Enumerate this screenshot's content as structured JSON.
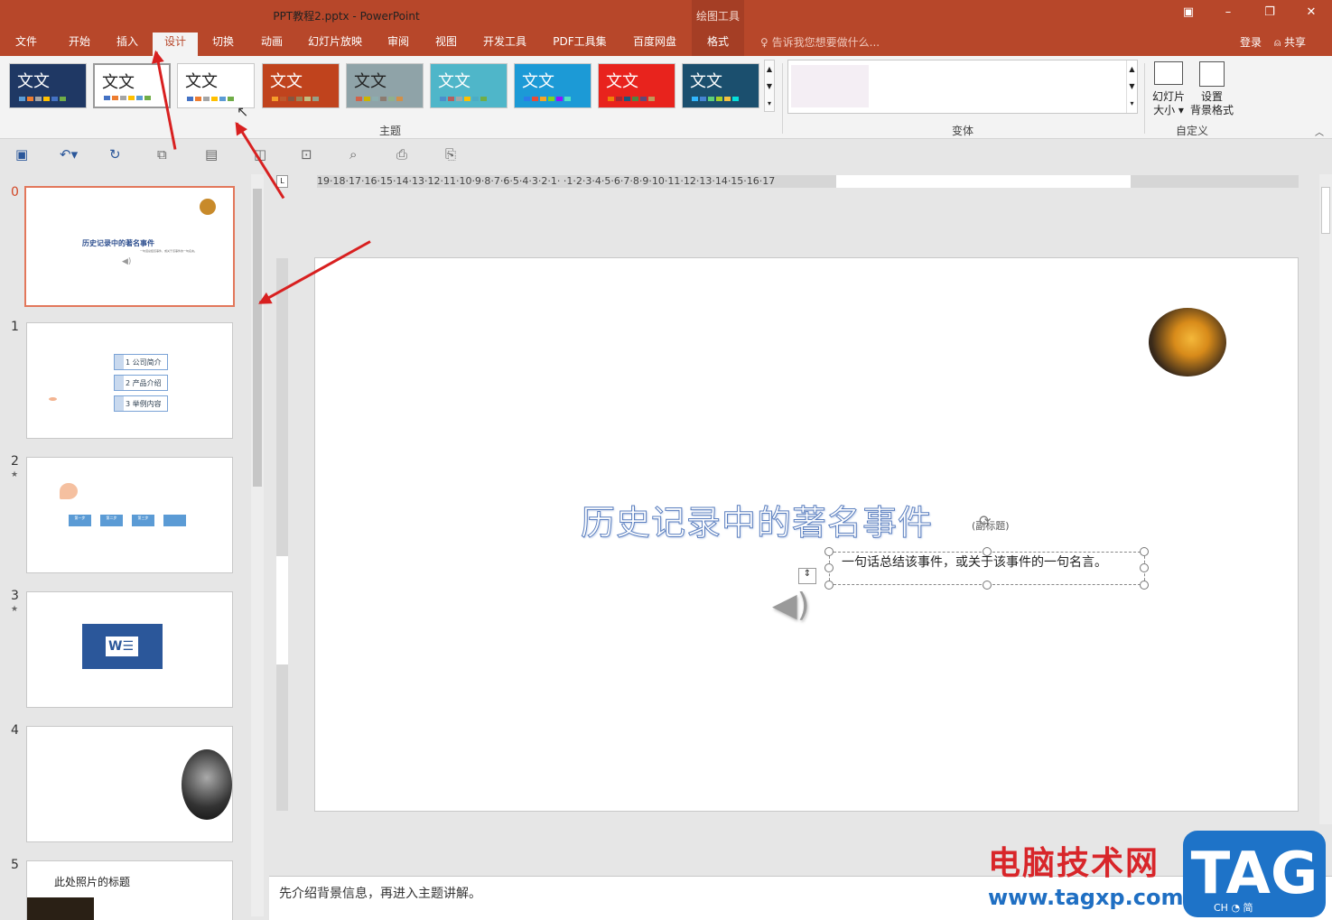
{
  "window": {
    "title": "PPT教程2.pptx - PowerPoint",
    "context_tool": "绘图工具",
    "min": "–",
    "restore": "❐",
    "close": "✕",
    "opts": "▣"
  },
  "tabs": [
    "文件",
    "开始",
    "插入",
    "设计",
    "切换",
    "动画",
    "幻灯片放映",
    "审阅",
    "视图",
    "开发工具",
    "PDF工具集",
    "百度网盘",
    "格式"
  ],
  "tell_me": "告诉我您想要做什么...",
  "login": "登录",
  "share": "共享",
  "ribbon": {
    "theme_sample": "文文",
    "themes_label": "主题",
    "variants_label": "变体",
    "customize_label": "自定义",
    "slide_size": "幻灯片\n大小",
    "slide_size_l1": "幻灯片",
    "slide_size_l2": "大小",
    "bg_l1": "设置",
    "bg_l2": "背景格式"
  },
  "themes": [
    {
      "bg": "#1f3864",
      "fg": "#ffffff",
      "sw": [
        "#5b9bd5",
        "#ed7d31",
        "#a5a5a5",
        "#ffc000",
        "#4472c4",
        "#70ad47"
      ]
    },
    {
      "bg": "#ffffff",
      "fg": "#222222",
      "sw": [
        "#4472c4",
        "#ed7d31",
        "#a5a5a5",
        "#ffc000",
        "#5b9bd5",
        "#70ad47"
      ]
    },
    {
      "bg": "#ffffff",
      "fg": "#222222",
      "sw": [
        "#4472c4",
        "#ed7d31",
        "#a5a5a5",
        "#ffc000",
        "#5b9bd5",
        "#70ad47"
      ]
    },
    {
      "bg": "#c0431d",
      "fg": "#ffffff",
      "sw": [
        "#f59c2a",
        "#bd582c",
        "#865640",
        "#9b8357",
        "#c2bc80",
        "#94a088"
      ]
    },
    {
      "bg": "#8fa3a8",
      "fg": "#222222",
      "sw": [
        "#d16349",
        "#ccb400",
        "#8cadae",
        "#8c7b70",
        "#8fb08c",
        "#d19049"
      ]
    },
    {
      "bg": "#4fb6c9",
      "fg": "#ffffff",
      "sw": [
        "#4b8ecc",
        "#b45f5f",
        "#a5a5a5",
        "#ffc000",
        "#4bacc6",
        "#70ad47"
      ]
    },
    {
      "bg": "#1c9ad6",
      "fg": "#ffffff",
      "sw": [
        "#2b7de9",
        "#e84b37",
        "#f5a623",
        "#7ed321",
        "#9013fe",
        "#50e3c2"
      ]
    },
    {
      "bg": "#e8231d",
      "fg": "#ffffff",
      "sw": [
        "#f07f09",
        "#9f2936",
        "#1b587c",
        "#4e8542",
        "#604878",
        "#c19859"
      ]
    },
    {
      "bg": "#1b4f6e",
      "fg": "#ffffff",
      "sw": [
        "#31b6fd",
        "#4584d3",
        "#5bd078",
        "#a5d028",
        "#f5c040",
        "#05e0db"
      ]
    }
  ],
  "slides": [
    {
      "num": "0",
      "title": "历史记录中的著名事件",
      "tagline": "一句话总结该事件，或关于该事件的一句名言。"
    },
    {
      "num": "1",
      "items": [
        "1 公司简介",
        "2 产品介绍",
        "3 举例内容"
      ]
    },
    {
      "num": "2",
      "steps": [
        "第一步",
        "第二步",
        "第三步",
        ""
      ]
    },
    {
      "num": "3"
    },
    {
      "num": "4"
    },
    {
      "num": "5",
      "title": "此处照片的标题"
    }
  ],
  "editor": {
    "title": "历史记录中的著名事件",
    "title_hint": "(副标题)",
    "subtitle": "一句话总结该事件，或关于该事件的一句名言。",
    "notes": "先介绍背景信息，再进入主题讲解。"
  },
  "ruler_h": "19·18·17·16·15·14·13·12·11·10·9·8·7·6·5·4·3·2·1·  ·1·2·3·4·5·6·7·8·9·10·11·12·13·14·15·16·17",
  "watermark": {
    "cn": "电脑技术网",
    "url": "www.tagxp.com",
    "logo": "TAG",
    "ime": "CH ◔ 简"
  }
}
